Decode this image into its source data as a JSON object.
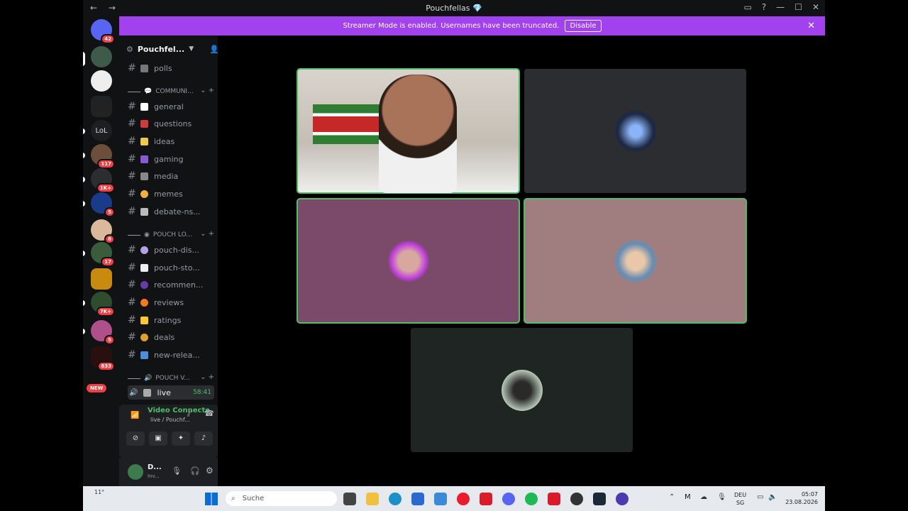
{
  "window": {
    "title": "Pouchfellas 💎",
    "nav": "← →"
  },
  "banner": {
    "text": "Streamer Mode is enabled. Usernames have been truncated.",
    "disable_label": "Disable",
    "close": "✕"
  },
  "rail": {
    "badges": [
      "42",
      "117",
      "1K+",
      "5",
      "8",
      "17",
      "7K+",
      "5",
      "833"
    ],
    "new_label": "NEW",
    "lol_label": "LoL"
  },
  "sidebar": {
    "server_name": "Pouchfel...",
    "channels_top": [
      {
        "name": "polls"
      }
    ],
    "category1": "COMMUNI...",
    "channels1": [
      "general",
      "questions",
      "ideas",
      "gaming",
      "media",
      "memes",
      "debate-ns..."
    ],
    "category2": "POUCH LO...",
    "channels2": [
      "pouch-dis...",
      "pouch-sto...",
      "recommen...",
      "reviews",
      "ratings",
      "deals",
      "new-relea..."
    ],
    "category3": "POUCH V...",
    "voice_channel": {
      "name": "live",
      "timer": "58:41"
    }
  },
  "voice_panel": {
    "status": "Video Connecte",
    "location": "live / Pouchf..."
  },
  "user_panel": {
    "name": "D...",
    "status": "Inv..."
  },
  "stage": {
    "tiles": 5
  },
  "taskbar": {
    "search_placeholder": "Suche",
    "weather": "11°",
    "lang_top": "DEU",
    "lang_bottom": "SG",
    "time": "05:07",
    "date": "23.08.2026"
  },
  "colors": {
    "accent": "#a241ee",
    "speaking": "#4fbd6a",
    "badge": "#f23f43"
  }
}
